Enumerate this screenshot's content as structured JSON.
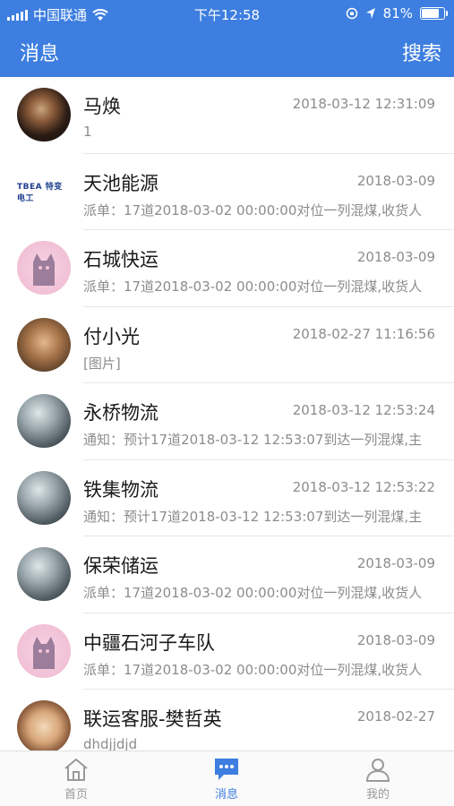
{
  "status_bar": {
    "carrier": "中国联通",
    "time": "下午12:58",
    "battery_percent": "81%",
    "battery_level": 0.81
  },
  "nav": {
    "title": "消息",
    "action": "搜索"
  },
  "messages": [
    {
      "name": "马焕",
      "time": "2018-03-12 12:31:09",
      "preview": "1",
      "avatar": "dark-portrait"
    },
    {
      "name": "天池能源",
      "time": "2018-03-09",
      "preview": "派单：17道2018-03-02 00:00:00对位一列混煤,收货人",
      "avatar": "logo",
      "logo_text": "TBEA 特变电工"
    },
    {
      "name": "石城快运",
      "time": "2018-03-09",
      "preview": "派单：17道2018-03-02 00:00:00对位一列混煤,收货人",
      "avatar": "cat"
    },
    {
      "name": "付小光",
      "time": "2018-02-27 11:16:56",
      "preview": "[图片]",
      "avatar": "man-portrait"
    },
    {
      "name": "永桥物流",
      "time": "2018-03-12 12:53:24",
      "preview": "通知：预计17道2018-03-12 12:53:07到达一列混煤,主",
      "avatar": "globe"
    },
    {
      "name": "铁集物流",
      "time": "2018-03-12 12:53:22",
      "preview": "通知：预计17道2018-03-12 12:53:07到达一列混煤,主",
      "avatar": "globe"
    },
    {
      "name": "保荣储运",
      "time": "2018-03-09",
      "preview": "派单：17道2018-03-02 00:00:00对位一列混煤,收货人",
      "avatar": "globe"
    },
    {
      "name": "中疆石河子车队",
      "time": "2018-03-09",
      "preview": "派单：17道2018-03-02 00:00:00对位一列混煤,收货人",
      "avatar": "cat"
    },
    {
      "name": "联运客服-樊哲英",
      "time": "2018-02-27",
      "preview": "dhdjjdjd",
      "avatar": "kid-portrait"
    }
  ],
  "tabs": [
    {
      "label": "首页",
      "icon": "home-icon",
      "active": false
    },
    {
      "label": "消息",
      "icon": "chat-icon",
      "active": true
    },
    {
      "label": "我的",
      "icon": "user-icon",
      "active": false
    }
  ],
  "colors": {
    "primary": "#3d7ee0",
    "text": "#1a1a1a",
    "secondary_text": "#8c8c8c",
    "inactive_tab": "#9a9a9a"
  }
}
